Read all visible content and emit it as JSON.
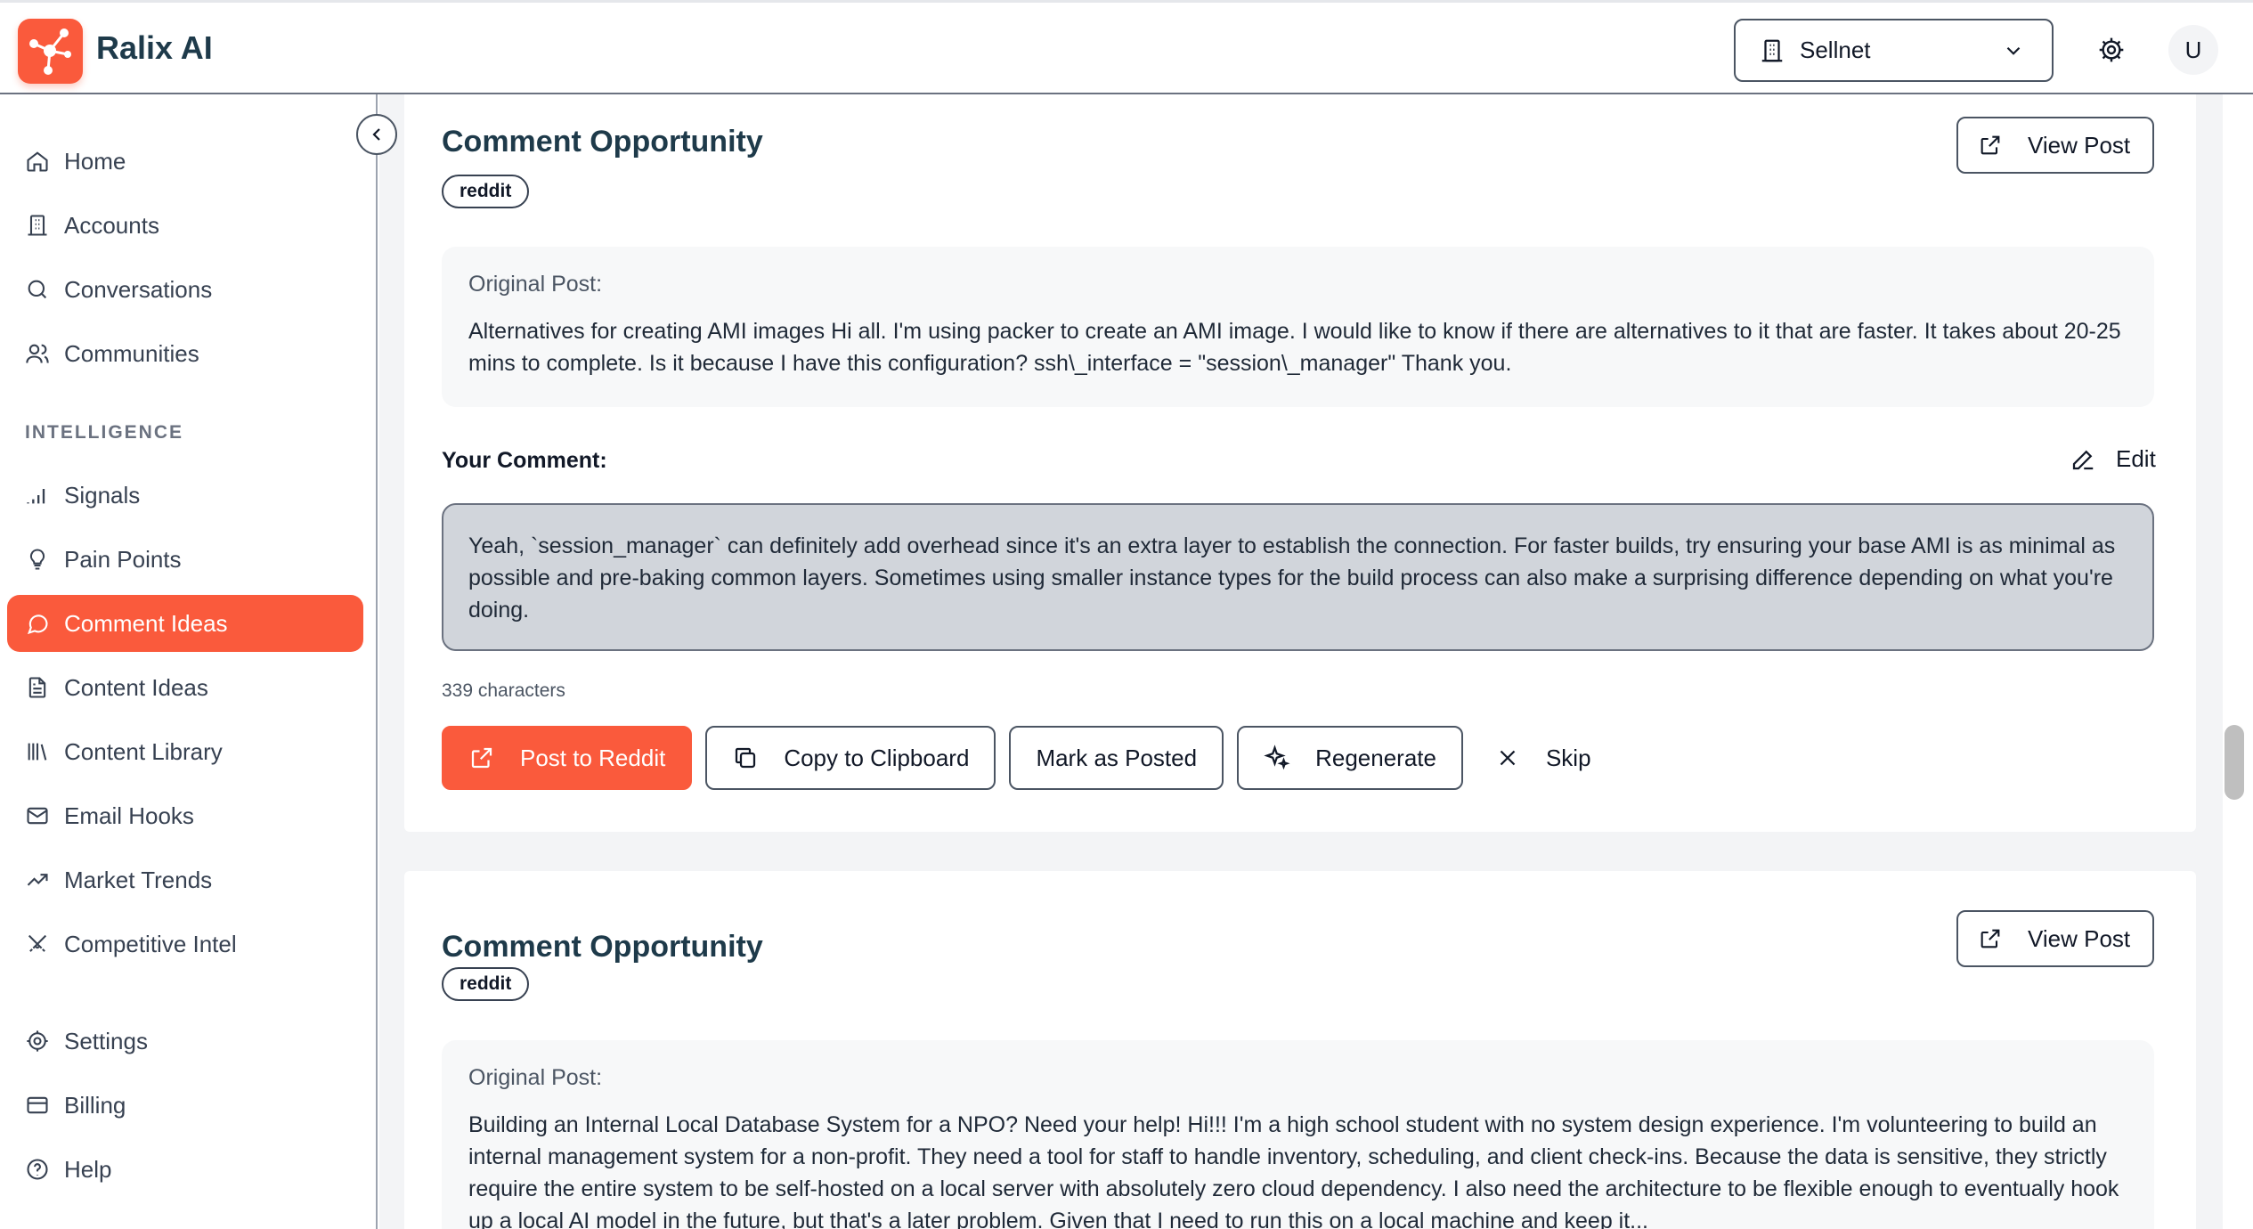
{
  "header": {
    "app_name": "Ralix AI",
    "workspace": "Sellnet",
    "avatar_initial": "U"
  },
  "sidebar": {
    "items_top": [
      {
        "label": "Home",
        "icon": "home-icon"
      },
      {
        "label": "Accounts",
        "icon": "building-icon"
      },
      {
        "label": "Conversations",
        "icon": "search-icon"
      },
      {
        "label": "Communities",
        "icon": "users-icon"
      }
    ],
    "section_label": "INTELLIGENCE",
    "items_intel": [
      {
        "label": "Signals",
        "icon": "signal-bars-icon"
      },
      {
        "label": "Pain Points",
        "icon": "lightbulb-icon"
      },
      {
        "label": "Comment Ideas",
        "icon": "message-circle-icon",
        "active": true
      },
      {
        "label": "Content Ideas",
        "icon": "file-text-icon"
      },
      {
        "label": "Content Library",
        "icon": "library-icon"
      },
      {
        "label": "Email Hooks",
        "icon": "mail-icon"
      },
      {
        "label": "Market Trends",
        "icon": "trending-up-icon"
      },
      {
        "label": "Competitive Intel",
        "icon": "swords-icon"
      }
    ],
    "items_bottom": [
      {
        "label": "Settings",
        "icon": "gear-icon"
      },
      {
        "label": "Billing",
        "icon": "credit-card-icon"
      },
      {
        "label": "Help",
        "icon": "help-circle-icon"
      }
    ]
  },
  "cards": [
    {
      "title": "Comment Opportunity",
      "tag": "reddit",
      "view_post": "View Post",
      "original_label": "Original Post:",
      "original_text": "Alternatives for creating AMI images Hi all. I'm using packer to create an AMI image. I would like to know if there are alternatives to it that are faster. It takes about 20-25 mins to complete. Is it because I have this configuration? ssh\\_interface = \"session\\_manager\" Thank you.",
      "your_comment_label": "Your Comment:",
      "edit_label": "Edit",
      "comment_text": "Yeah, `session_manager` can definitely add overhead since it's an extra layer to establish the connection. For faster builds, try ensuring your base AMI is as minimal as possible and pre-baking common layers. Sometimes using smaller instance types for the build process can also make a surprising difference depending on what you're doing.",
      "char_count": "339 characters",
      "actions": {
        "post": "Post to Reddit",
        "copy": "Copy to Clipboard",
        "mark": "Mark as Posted",
        "regenerate": "Regenerate",
        "skip": "Skip"
      }
    },
    {
      "title": "Comment Opportunity",
      "tag": "reddit",
      "view_post": "View Post",
      "original_label": "Original Post:",
      "original_text": "Building an Internal Local Database System for a NPO? Need your help! Hi!!! I'm a high school student with no system design experience. I'm volunteering to build an internal management system for a non-profit. They need a tool for staff to handle inventory, scheduling, and client check-ins. Because the data is sensitive, they strictly require the entire system to be self-hosted on a local server with absolutely zero cloud dependency. I also need the architecture to be flexible enough to eventually hook up a local AI model in the future, but that's a later problem. Given that I need to run this on a local machine and keep it..."
    }
  ],
  "colors": {
    "accent": "#fa5a3c",
    "title": "#1e3a4a",
    "comment_bg": "#d1d5db"
  }
}
